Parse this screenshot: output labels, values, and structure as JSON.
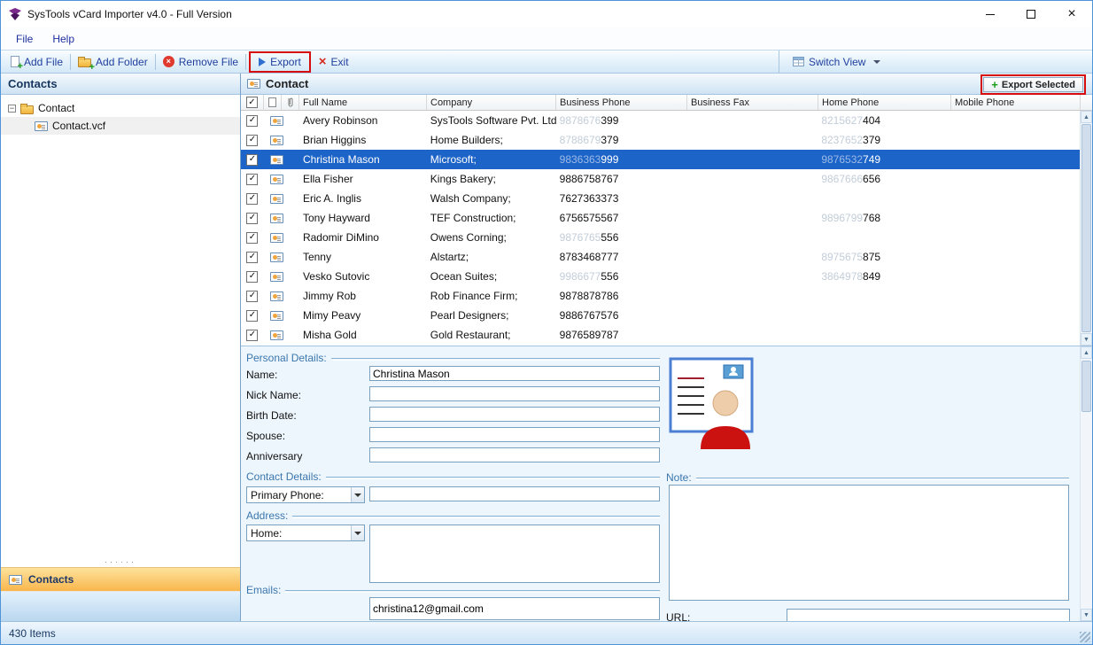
{
  "window": {
    "title": "SysTools vCard Importer v4.0 - Full Version"
  },
  "menu": {
    "file": "File",
    "help": "Help"
  },
  "toolbar": {
    "add_file": "Add File",
    "add_folder": "Add Folder",
    "remove_file": "Remove File",
    "export": "Export",
    "exit": "Exit",
    "switch_view": "Switch View"
  },
  "sidebar": {
    "header": "Contacts",
    "tree": {
      "root": "Contact",
      "child": "Contact.vcf"
    },
    "bottom_button": "Contacts"
  },
  "main": {
    "header": "Contact",
    "export_selected_label": "Export Selected",
    "table": {
      "columns": [
        "Full Name",
        "Company",
        "Business Phone",
        "Business Fax",
        "Home Phone",
        "Mobile Phone"
      ],
      "rows": [
        {
          "full_name": "Avery Robinson",
          "company": "SysTools Software Pvt. Ltd.;",
          "business_phone_dim": "9878676",
          "business_phone": "399",
          "business_fax": "",
          "home_phone_dim": "8215627",
          "home_phone": "404",
          "mobile_phone": "",
          "checked": true,
          "selected": false
        },
        {
          "full_name": "Brian Higgins",
          "company": "Home Builders;",
          "business_phone_dim": "8788679",
          "business_phone": "379",
          "business_fax": "",
          "home_phone_dim": "8237652",
          "home_phone": "379",
          "mobile_phone": "",
          "checked": true,
          "selected": false
        },
        {
          "full_name": "Christina Mason",
          "company": "Microsoft;",
          "business_phone_dim": "9836363",
          "business_phone": "999",
          "business_fax": "",
          "home_phone_dim": "9876532",
          "home_phone": "749",
          "mobile_phone": "",
          "checked": true,
          "selected": true
        },
        {
          "full_name": "Ella Fisher",
          "company": "Kings Bakery;",
          "business_phone_dim": "",
          "business_phone": "9886758767",
          "business_fax": "",
          "home_phone_dim": "9867666",
          "home_phone": "656",
          "mobile_phone": "",
          "checked": true,
          "selected": false
        },
        {
          "full_name": "Eric A. Inglis",
          "company": "Walsh Company;",
          "business_phone_dim": "",
          "business_phone": "7627363373",
          "business_fax": "",
          "home_phone_dim": "",
          "home_phone": "",
          "mobile_phone": "",
          "checked": true,
          "selected": false
        },
        {
          "full_name": "Tony Hayward",
          "company": "TEF Construction;",
          "business_phone_dim": "",
          "business_phone": "6756575567",
          "business_fax": "",
          "home_phone_dim": "9896799",
          "home_phone": "768",
          "mobile_phone": "",
          "checked": true,
          "selected": false
        },
        {
          "full_name": "Radomir DiMino",
          "company": "Owens Corning;",
          "business_phone_dim": "9876765",
          "business_phone": "556",
          "business_fax": "",
          "home_phone_dim": "",
          "home_phone": "",
          "mobile_phone": "",
          "checked": true,
          "selected": false
        },
        {
          "full_name": "Tenny",
          "company": "Alstartz;",
          "business_phone_dim": "",
          "business_phone": "8783468777",
          "business_fax": "",
          "home_phone_dim": "8975675",
          "home_phone": "875",
          "mobile_phone": "",
          "checked": true,
          "selected": false
        },
        {
          "full_name": "Vesko Sutovic",
          "company": "Ocean Suites;",
          "business_phone_dim": "9986677",
          "business_phone": "556",
          "business_fax": "",
          "home_phone_dim": "3864978",
          "home_phone": "849",
          "mobile_phone": "",
          "checked": true,
          "selected": false
        },
        {
          "full_name": "Jimmy Rob",
          "company": "Rob Finance Firm;",
          "business_phone_dim": "",
          "business_phone": "9878878786",
          "business_fax": "",
          "home_phone_dim": "",
          "home_phone": "",
          "mobile_phone": "",
          "checked": true,
          "selected": false
        },
        {
          "full_name": "Mimy Peavy",
          "company": "Pearl Designers;",
          "business_phone_dim": "",
          "business_phone": "9886767576",
          "business_fax": "",
          "home_phone_dim": "",
          "home_phone": "",
          "mobile_phone": "",
          "checked": true,
          "selected": false
        },
        {
          "full_name": "Misha Gold",
          "company": "Gold Restaurant;",
          "business_phone_dim": "",
          "business_phone": "9876589787",
          "business_fax": "",
          "home_phone_dim": "",
          "home_phone": "",
          "mobile_phone": "",
          "checked": true,
          "selected": false
        }
      ]
    }
  },
  "details": {
    "sections": {
      "personal": "Personal Details:",
      "contact": "Contact Details:",
      "address": "Address:",
      "emails": "Emails:",
      "note": "Note:",
      "url": "URL:"
    },
    "fields": [
      {
        "label": "Name:",
        "value": "Christina Mason"
      },
      {
        "label": "Nick Name:",
        "value": ""
      },
      {
        "label": "Birth Date:",
        "value": ""
      },
      {
        "label": "Spouse:",
        "value": ""
      },
      {
        "label": "Anniversary",
        "value": ""
      }
    ],
    "phone_type": "Primary Phone:",
    "phone_value": "",
    "address_type": "Home:",
    "address_value": "",
    "email_value": "christina12@gmail.com",
    "note_value": "",
    "url_value": ""
  },
  "statusbar": {
    "items": "430 Items"
  },
  "icons": {
    "app": "systools-logo",
    "add_file": "file-plus-icon",
    "add_folder": "folder-plus-icon",
    "remove_file": "red-cross-circle-icon",
    "export": "blue-arrow-icon",
    "exit": "red-x-icon",
    "switch_view": "grid-icon",
    "export_selected": "green-plus-icon",
    "attachment": "paperclip-icon",
    "contact_card": "contact-card-icon",
    "checkbox_check": "✓"
  },
  "colors": {
    "selection_blue": "#1d64c8",
    "highlight_red": "#d60d0d",
    "accent_orange": "#f9b64c",
    "section_label_blue": "#3a76ad"
  }
}
